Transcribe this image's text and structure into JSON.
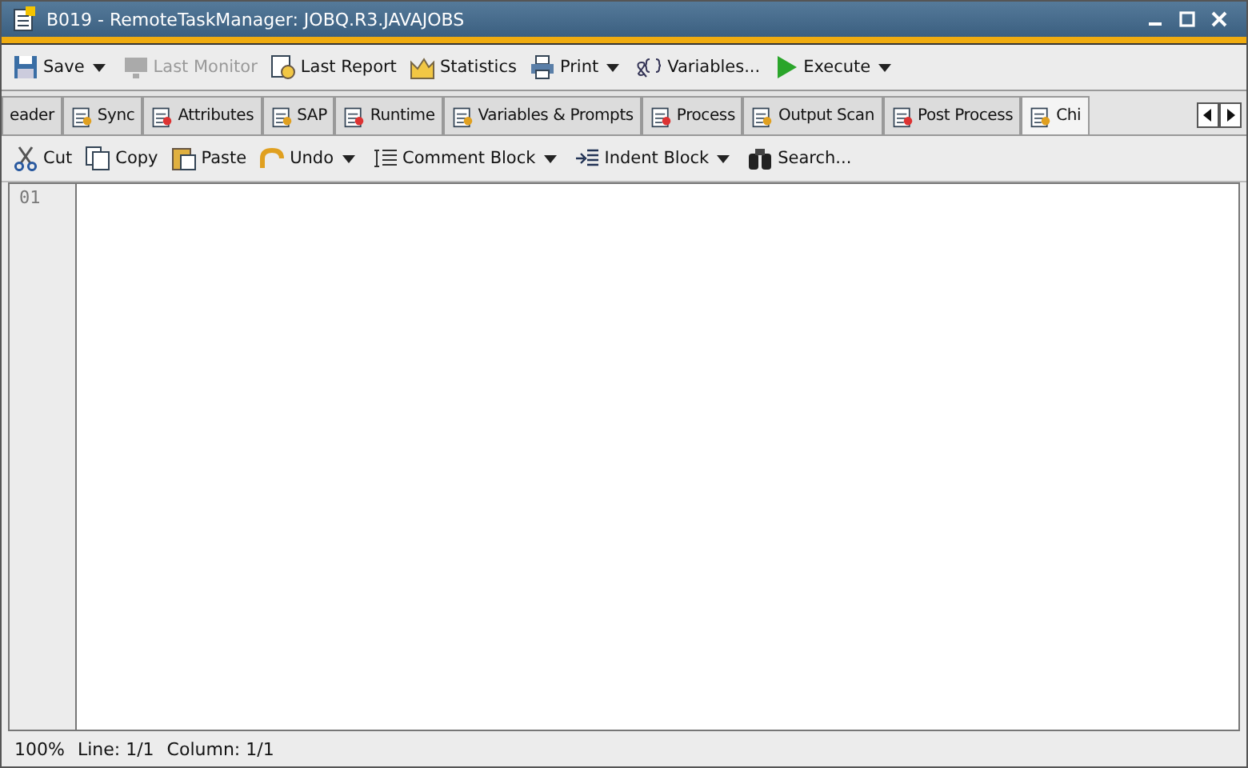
{
  "window": {
    "title": "B019 - RemoteTaskManager: JOBQ.R3.JAVAJOBS"
  },
  "toolbar": [
    {
      "label": "Save",
      "has_menu": true,
      "disabled": false
    },
    {
      "label": "Last Monitor",
      "has_menu": false,
      "disabled": true
    },
    {
      "label": "Last Report",
      "has_menu": false,
      "disabled": false
    },
    {
      "label": "Statistics",
      "has_menu": false,
      "disabled": false
    },
    {
      "label": "Print",
      "has_menu": true,
      "disabled": false
    },
    {
      "label": "Variables...",
      "has_menu": false,
      "disabled": false
    },
    {
      "label": "Execute",
      "has_menu": true,
      "disabled": false
    }
  ],
  "tabs": [
    {
      "label": "eader",
      "selected": false
    },
    {
      "label": "Sync",
      "selected": false
    },
    {
      "label": "Attributes",
      "selected": false
    },
    {
      "label": "SAP",
      "selected": false
    },
    {
      "label": "Runtime",
      "selected": false
    },
    {
      "label": "Variables & Prompts",
      "selected": false
    },
    {
      "label": "Process",
      "selected": false
    },
    {
      "label": "Output Scan",
      "selected": false
    },
    {
      "label": "Post Process",
      "selected": false
    },
    {
      "label": "Chi",
      "selected": true
    }
  ],
  "editor_toolbar": [
    {
      "label": "Cut",
      "has_menu": false
    },
    {
      "label": "Copy",
      "has_menu": false
    },
    {
      "label": "Paste",
      "has_menu": false
    },
    {
      "label": "Undo",
      "has_menu": true
    },
    {
      "label": "Comment Block",
      "has_menu": true
    },
    {
      "label": "Indent Block",
      "has_menu": true
    },
    {
      "label": "Search...",
      "has_menu": false
    }
  ],
  "editor": {
    "line_numbers": [
      "01"
    ]
  },
  "status_bar": {
    "zoom": "100%",
    "line": "Line: 1/1",
    "column": "Column: 1/1"
  }
}
